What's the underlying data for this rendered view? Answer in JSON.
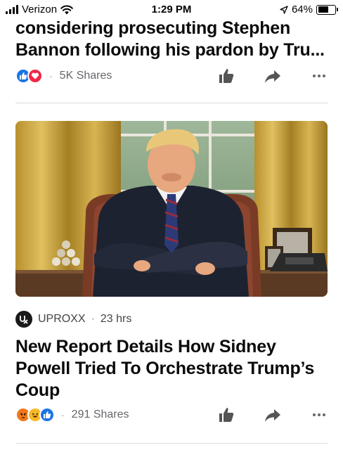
{
  "status_bar": {
    "carrier": "Verizon",
    "time": "1:29 PM",
    "battery": "64%",
    "battery_level": 0.64
  },
  "articles": [
    {
      "headline": "considering prosecuting Stephen Bannon following his pardon by Tru...",
      "reactions": [
        "like-icon",
        "love-icon"
      ],
      "shares": "5K Shares"
    },
    {
      "image_desc": "photo",
      "source": "UPROXX",
      "source_logo_text": "UPROXX",
      "time_ago": "23 hrs",
      "headline": "New Report Details How Sidney Powell Tried To Orchestrate Trump’s Coup",
      "reactions": [
        "angry-icon",
        "haha-icon",
        "like-icon"
      ],
      "shares": "291 Shares"
    }
  ],
  "colors": {
    "like": "#1b74e4",
    "love": "#f02849",
    "angry": "#f0781b",
    "haha": "#f7b928",
    "meta_text": "#65676b"
  }
}
